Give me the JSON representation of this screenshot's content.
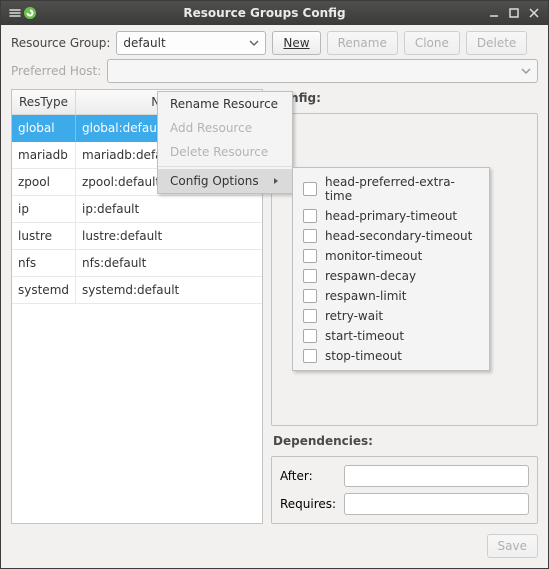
{
  "titlebar": {
    "title": "Resource Groups Config"
  },
  "toolbar": {
    "resource_group_label": "Resource Group:",
    "resource_group_value": "default",
    "preferred_host_label": "Preferred Host:",
    "preferred_host_value": "",
    "new_label": "New",
    "rename_label": "Rename",
    "clone_label": "Clone",
    "delete_label": "Delete"
  },
  "table": {
    "col1": "ResType",
    "col2": "Name",
    "rows": [
      {
        "type": "global",
        "name": "global:default"
      },
      {
        "type": "mariadb",
        "name": "mariadb:default"
      },
      {
        "type": "zpool",
        "name": "zpool:default"
      },
      {
        "type": "ip",
        "name": "ip:default"
      },
      {
        "type": "lustre",
        "name": "lustre:default"
      },
      {
        "type": "nfs",
        "name": "nfs:default"
      },
      {
        "type": "systemd",
        "name": "systemd:default"
      }
    ],
    "selected_index": 0
  },
  "context_menu": {
    "rename": "Rename Resource",
    "add": "Add Resource",
    "delete": "Delete Resource",
    "config_options": "Config Options"
  },
  "config_options_submenu": [
    "head-preferred-extra-time",
    "head-primary-timeout",
    "head-secondary-timeout",
    "monitor-timeout",
    "respawn-decay",
    "respawn-limit",
    "retry-wait",
    "start-timeout",
    "stop-timeout"
  ],
  "right_panel": {
    "config_label": "Config:",
    "dependencies_label": "Dependencies:",
    "after_label": "After:",
    "requires_label": "Requires:",
    "after_value": "",
    "requires_value": ""
  },
  "footer": {
    "save_label": "Save"
  }
}
